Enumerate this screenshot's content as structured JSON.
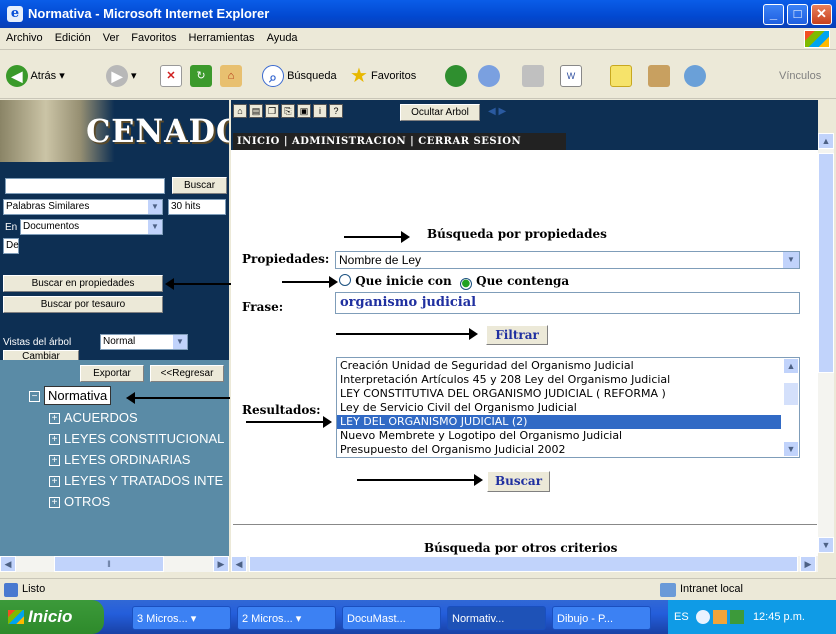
{
  "window": {
    "title": "Normativa - Microsoft Internet Explorer"
  },
  "menu": [
    "Archivo",
    "Edición",
    "Ver",
    "Favoritos",
    "Herramientas",
    "Ayuda"
  ],
  "toolbar": {
    "back": "Atrás",
    "search": "Búsqueda",
    "favorites": "Favoritos",
    "links": "Vínculos"
  },
  "left": {
    "logo": "CENADO",
    "search_button": "Buscar",
    "similar_select": "Palabras Similares",
    "hits_select": "30 hits",
    "en_label": "En",
    "docs_select": "Documentos",
    "de_label": "De",
    "props_button": "Buscar en propiedades",
    "thesaurus_button": "Buscar por tesauro",
    "view_label": "Vistas del árbol",
    "view_select": "Normal",
    "change_button": "Cambiar",
    "export_button": "Exportar",
    "back_button": "<<Regresar",
    "tree_root": "Normativa",
    "tree_items": [
      "ACUERDOS",
      "LEYES CONSTITUCIONAL",
      "LEYES ORDINARIAS",
      "LEYES Y TRATADOS INTE",
      "OTROS"
    ]
  },
  "right": {
    "hide_tree": "Ocultar Arbol",
    "nav": "INICIO  |  ADMINISTRACION  |  CERRAR SESION",
    "section_title": "Búsqueda por propiedades",
    "props_label": "Propiedades:",
    "props_value": "Nombre de Ley",
    "radio_starts": "Que inicie con",
    "radio_contains": "Que contenga",
    "phrase_label": "Frase:",
    "phrase_value": "organismo judicial",
    "filter_button": "Filtrar",
    "results_label": "Resultados:",
    "results": [
      "Creación Unidad de Seguridad del Organismo Judicial",
      "Interpretación Artículos 45 y 208  Ley del Organismo Judicial",
      "LEY CONSTITUTIVA DEL ORGANISMO JUDICIAL ( REFORMA )",
      "Ley de Servicio Civil del Organismo Judicial",
      "LEY DEL ORGANISMO JUDICIAL (2)",
      "Nuevo Membrete y Logotipo del Organismo Judicial",
      "Presupuesto del Organismo Judicial 2002"
    ],
    "selected_result": "LEY DEL ORGANISMO JUDICIAL (2)",
    "search_button": "Buscar",
    "other_criteria": "Búsqueda por otros criterios"
  },
  "status": {
    "text": "Listo",
    "zone": "Intranet local"
  },
  "taskbar": {
    "start": "Inicio",
    "tasks": [
      "3 Micros...",
      "2 Micros...",
      "DocuMast...",
      "Normativ...",
      "Dibujo - P..."
    ],
    "lang": "ES",
    "time": "12:45 p.m."
  }
}
